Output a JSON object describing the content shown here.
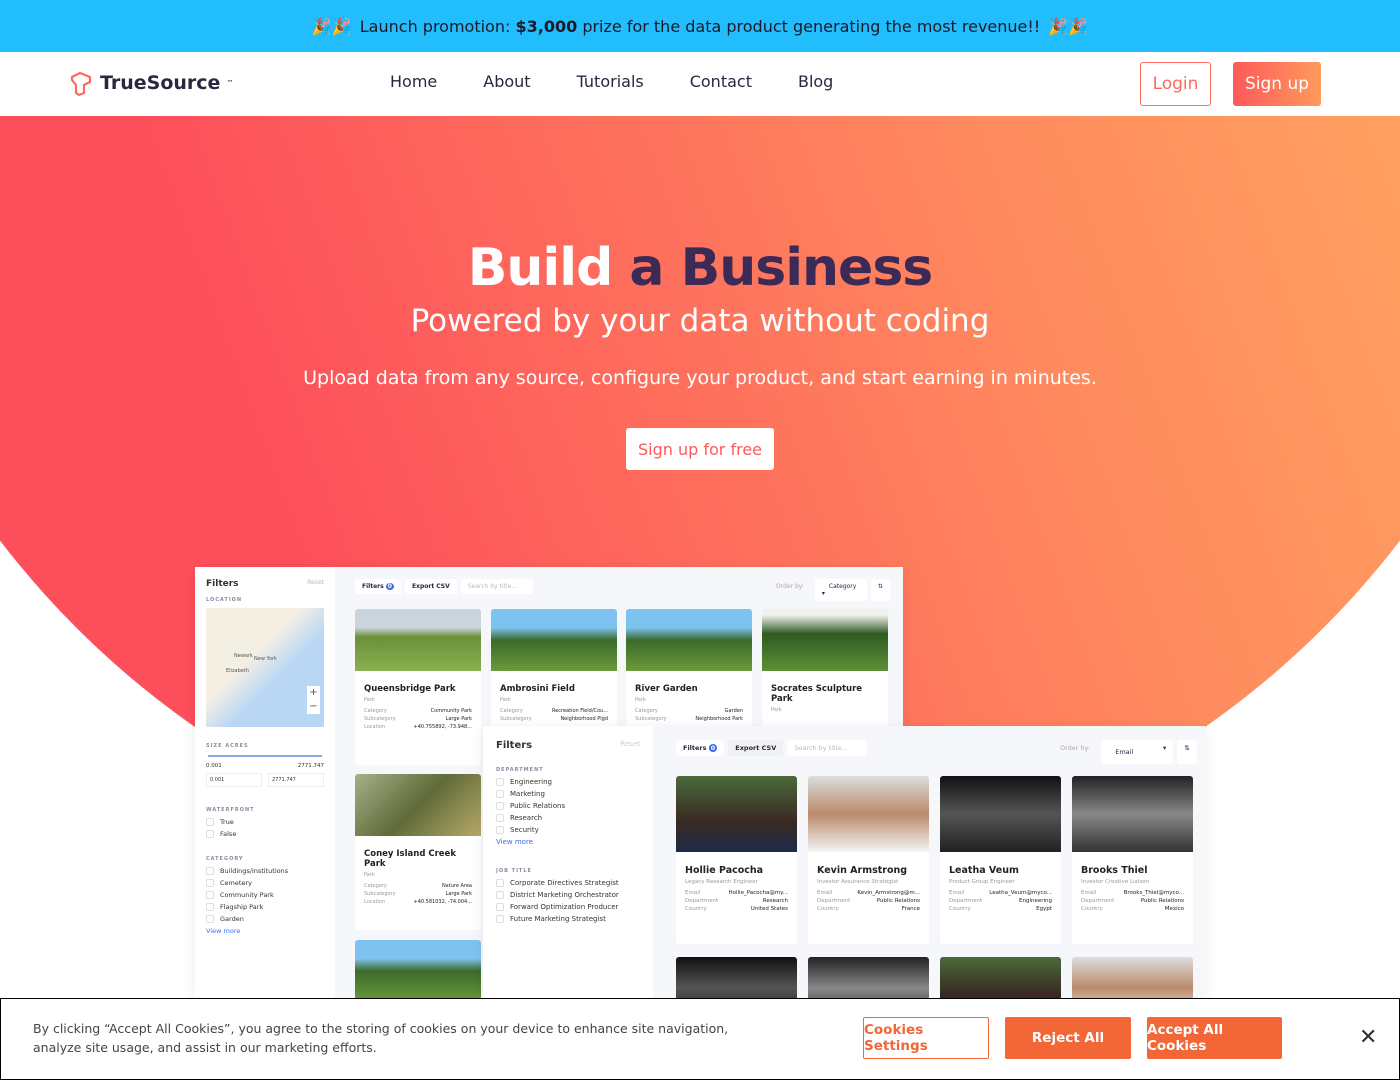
{
  "promo": {
    "emoji": "🎉🎉",
    "prefix": "Launch promotion:",
    "amount": "$3,000",
    "suffix": "prize for the data product generating the most revenue!!"
  },
  "nav": {
    "brand": "TrueSource",
    "tm": "™",
    "links": [
      "Home",
      "About",
      "Tutorials",
      "Contact",
      "Blog"
    ],
    "login": "Login",
    "signup": "Sign up"
  },
  "hero": {
    "title_a": "Build",
    "title_b": "a Business",
    "subtitle": "Powered by your data without coding",
    "text": "Upload data from any source, configure your product, and start earning in minutes.",
    "cta": "Sign up for free"
  },
  "parks": {
    "filters_title": "Filters",
    "reset": "Reset",
    "location": "LOCATION",
    "map_labels": [
      "Newark",
      "New York",
      "Elizabeth"
    ],
    "size_acres": "SIZE ACRES",
    "min": "0.001",
    "max": "2771.747",
    "waterfront": "WATERFRONT",
    "water_opts": [
      "True",
      "False"
    ],
    "category": "CATEGORY",
    "cat_opts": [
      "Buildings/institutions",
      "Cemetery",
      "Community Park",
      "Flagship Park",
      "Garden"
    ],
    "view_more": "View more",
    "toolbar": {
      "filters": "Filters",
      "badge": "0",
      "export": "Export CSV",
      "search_placeholder": "Search by title...",
      "order_label": "Order by:",
      "order_value": "Category"
    },
    "labels": {
      "category": "Category",
      "subcategory": "Subcategory",
      "location": "Location"
    },
    "cards": [
      {
        "title": "Queensbridge Park",
        "type": "Park",
        "category": "Community Park",
        "subcategory": "Large Park",
        "location": "+40.755892, -73.948..."
      },
      {
        "title": "Ambrosini Field",
        "type": "Park",
        "category": "Recreation Field/Cou...",
        "subcategory": "Neighborhood Plgd",
        "location": ""
      },
      {
        "title": "River Garden",
        "type": "Park",
        "category": "Garden",
        "subcategory": "Neighborhood Park",
        "location": ""
      },
      {
        "title": "Socrates Sculpture Park",
        "type": "Park"
      },
      {
        "title": "Coney Island Creek Park",
        "type": "Park",
        "category": "Nature Area",
        "subcategory": "Large Park",
        "location": "+40.581032, -74.004..."
      }
    ]
  },
  "people": {
    "filters_title": "Filters",
    "reset": "Reset",
    "department": "DEPARTMENT",
    "dept_opts": [
      "Engineering",
      "Marketing",
      "Public Relations",
      "Research",
      "Security"
    ],
    "view_more": "View more",
    "job_title": "JOB TITLE",
    "job_opts": [
      "Corporate Directives Strategist",
      "District Marketing Orchestrator",
      "Forward Optimization Producer",
      "Future Marketing Strategist"
    ],
    "toolbar": {
      "filters": "Filters",
      "badge": "0",
      "export": "Export CSV",
      "search_placeholder": "Search by title...",
      "order_label": "Order by:",
      "order_value": "Email"
    },
    "labels": {
      "email": "Email",
      "department": "Department",
      "country": "Country"
    },
    "cards": [
      {
        "name": "Hollie Pacocha",
        "role": "Legacy Research Engineer",
        "email": "Hollie_Pacocha@my...",
        "department": "Research",
        "country": "United States"
      },
      {
        "name": "Kevin Armstrong",
        "role": "Investor Assurance Strategist",
        "email": "Kevin_Armstrong@m...",
        "department": "Public Relations",
        "country": "France"
      },
      {
        "name": "Leatha Veum",
        "role": "Product Group Engineer",
        "email": "Leatha_Veum@myco...",
        "department": "Engineering",
        "country": "Egypt"
      },
      {
        "name": "Brooks Thiel",
        "role": "Investor Creative Liaison",
        "email": "Brooks_Thiel@myco...",
        "department": "Public Relations",
        "country": "Mexico"
      }
    ]
  },
  "cookie": {
    "text": "By clicking “Accept All Cookies”, you agree to the storing of cookies on your device to enhance site navigation, analyze site usage, and assist in our marketing efforts.",
    "settings": "Cookies Settings",
    "reject": "Reject All",
    "accept": "Accept All Cookies",
    "close": "✕"
  },
  "colors": {
    "promo": "#21bdfd",
    "accent": "#fd5a5a",
    "cookie_btn": "#f26637"
  }
}
